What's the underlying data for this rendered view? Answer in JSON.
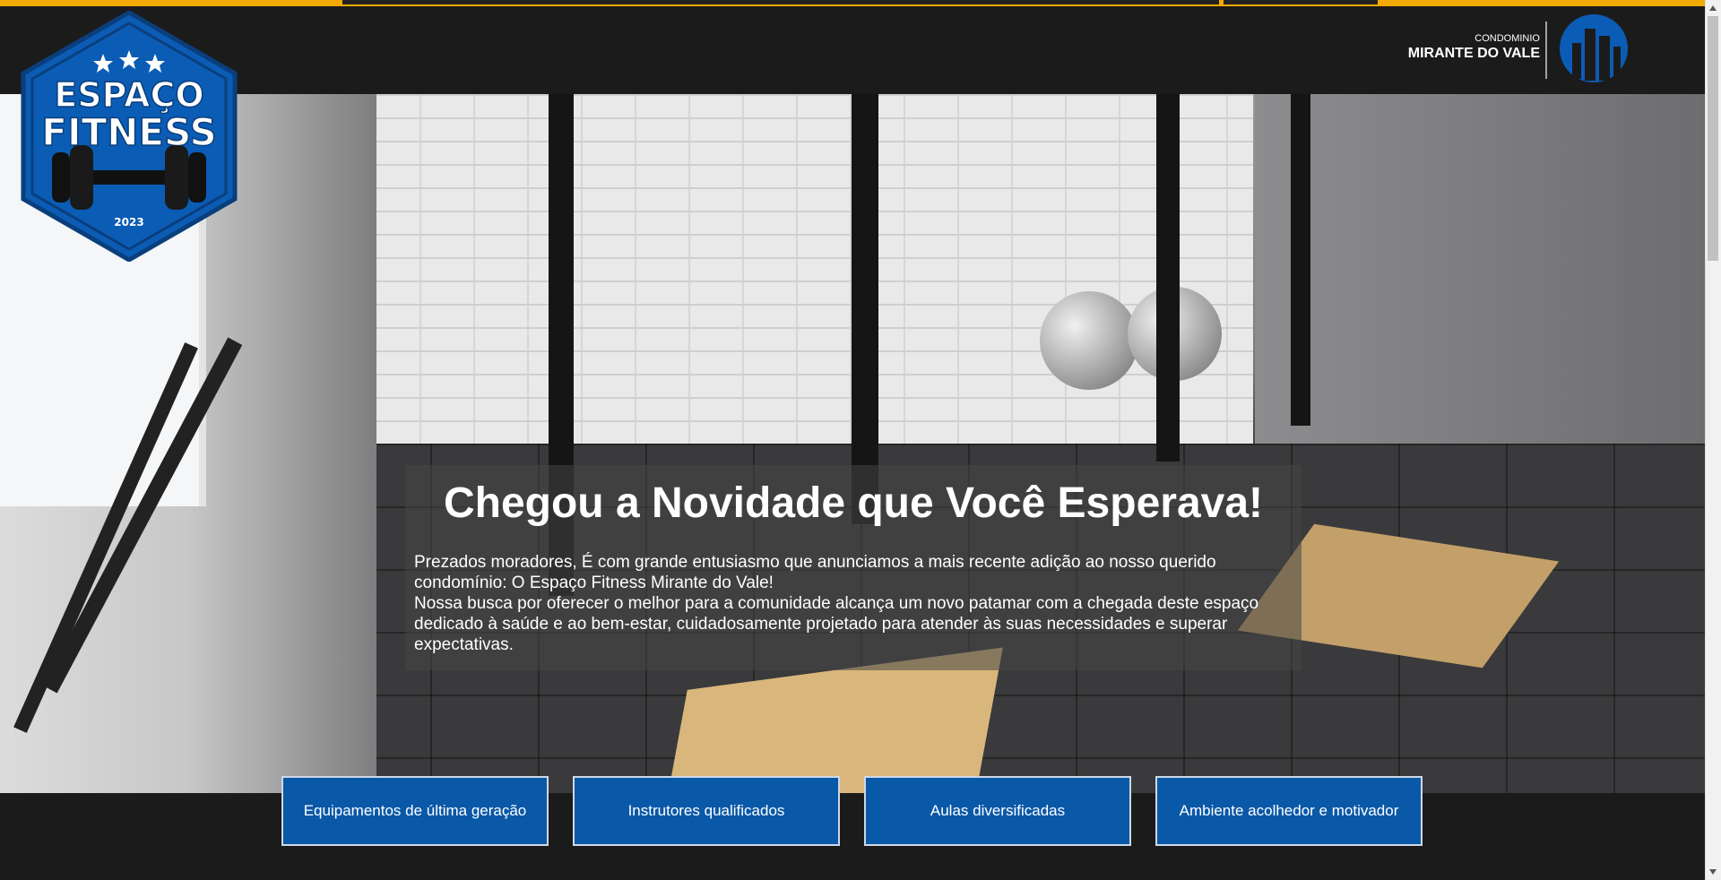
{
  "header": {
    "logo_left": {
      "line1": "ESPAÇO",
      "line2": "FITNESS",
      "year": "2023"
    },
    "logo_right": {
      "small": "CONDOMINIO",
      "big": "MIRANTE DO VALE"
    }
  },
  "hero": {
    "title": "Chegou a Novidade que Você Esperava!",
    "paragraph1": "Prezados moradores, É com grande entusiasmo que anunciamos a mais recente adição ao nosso querido condomínio: O Espaço Fitness Mirante do Vale!",
    "paragraph2": "Nossa busca por oferecer o melhor para a comunidade alcança um novo patamar com a chegada deste espaço dedicado à saúde e ao bem-estar, cuidadosamente projetado para atender às suas necessidades e superar expectativas."
  },
  "features": [
    {
      "label": "Equipamentos de última geração"
    },
    {
      "label": "Instrutores qualificados"
    },
    {
      "label": "Aulas diversificadas"
    },
    {
      "label": "Ambiente acolhedor e motivador"
    }
  ],
  "colors": {
    "accent_yellow": "#f2a900",
    "button_blue": "#0a58a8",
    "logo_blue": "#0b5cb5",
    "header_dark": "#1b1b1b"
  }
}
